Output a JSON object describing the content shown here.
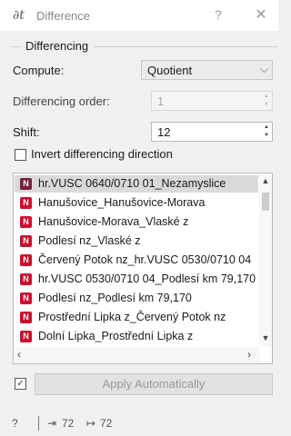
{
  "window": {
    "app_icon": "∂t",
    "title": "Difference",
    "help_glyph": "?",
    "close_glyph": "✕"
  },
  "differencing": {
    "group_title": "Differencing",
    "compute_label": "Compute:",
    "compute_value": "Quotient",
    "order_label": "Differencing order:",
    "order_value": "1",
    "shift_label": "Shift:",
    "shift_value": "12",
    "invert_label": "Invert differencing direction",
    "invert_checked": false
  },
  "variables": [
    {
      "label": "hr.VUSC 0640/0710 01_Nezamyslice",
      "selected": true
    },
    {
      "label": "Hanušovice_Hanušovice-Morava",
      "selected": false
    },
    {
      "label": "Hanušovice-Morava_Vlaské z",
      "selected": false
    },
    {
      "label": "Podlesí nz_Vlaské z",
      "selected": false
    },
    {
      "label": "Červený Potok nz_hr.VUSC 0530/0710 04",
      "selected": false
    },
    {
      "label": "hr.VUSC 0530/0710 04_Podlesí km 79,170",
      "selected": false
    },
    {
      "label": "Podlesí nz_Podlesí km 79,170",
      "selected": false
    },
    {
      "label": "Prostřední Lipka z_Červený Potok nz",
      "selected": false
    },
    {
      "label": "Dolní Lipka_Prostřední Lipka z",
      "selected": false
    }
  ],
  "variable_icon_letter": "N",
  "apply": {
    "auto_checked": true,
    "button_label": "Apply Automatically"
  },
  "status": {
    "help_glyph": "?",
    "input_icon": "⇥",
    "input_count": "72",
    "output_icon": "↦",
    "output_count": "72"
  },
  "colors": {
    "variable_icon": "#c8102e",
    "selected_row": "#d9d9d9"
  }
}
